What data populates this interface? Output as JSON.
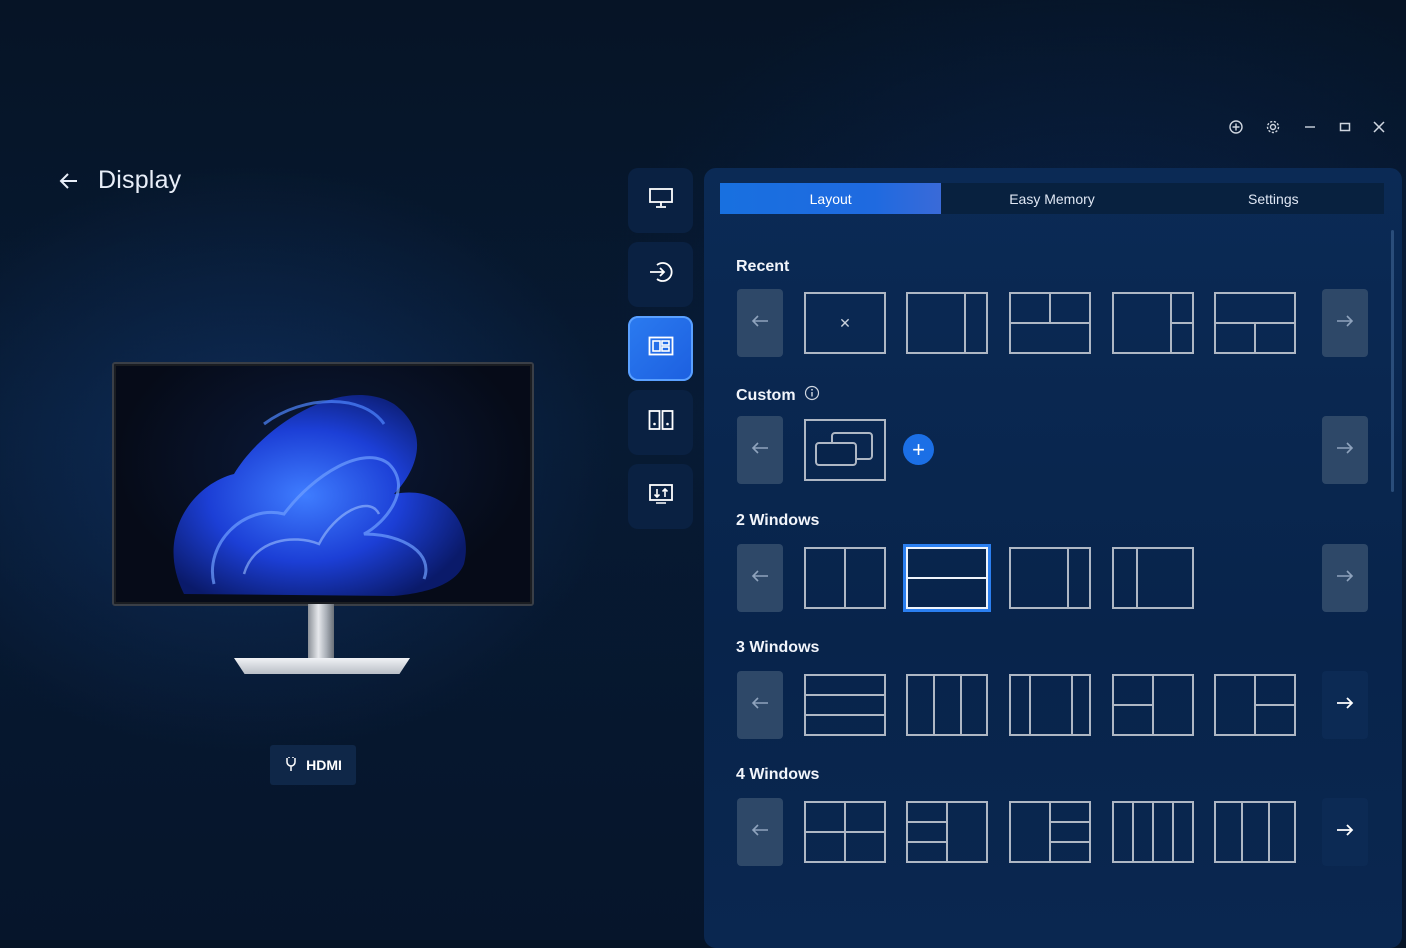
{
  "page": {
    "title": "Display"
  },
  "input_badge": {
    "label": "HDMI"
  },
  "tabs": [
    {
      "label": "Layout",
      "active": true
    },
    {
      "label": "Easy Memory",
      "active": false
    },
    {
      "label": "Settings",
      "active": false
    }
  ],
  "sections": {
    "recent": {
      "label": "Recent"
    },
    "custom": {
      "label": "Custom"
    },
    "two": {
      "label": "2 Windows"
    },
    "three": {
      "label": "3 Windows"
    },
    "four": {
      "label": "4 Windows"
    }
  },
  "rail": [
    {
      "icon": "monitor-icon",
      "active": false
    },
    {
      "icon": "input-source-icon",
      "active": false
    },
    {
      "icon": "layout-icon",
      "active": true
    },
    {
      "icon": "pip-pbp-icon",
      "active": false
    },
    {
      "icon": "display-adjust-icon",
      "active": false
    }
  ],
  "window_controls": [
    "target-icon",
    "gear-icon",
    "minimize-icon",
    "maximize-icon",
    "close-icon"
  ],
  "colors": {
    "accent": "#1b6fe6",
    "panel": "#0b2a55",
    "background": "#061426"
  }
}
